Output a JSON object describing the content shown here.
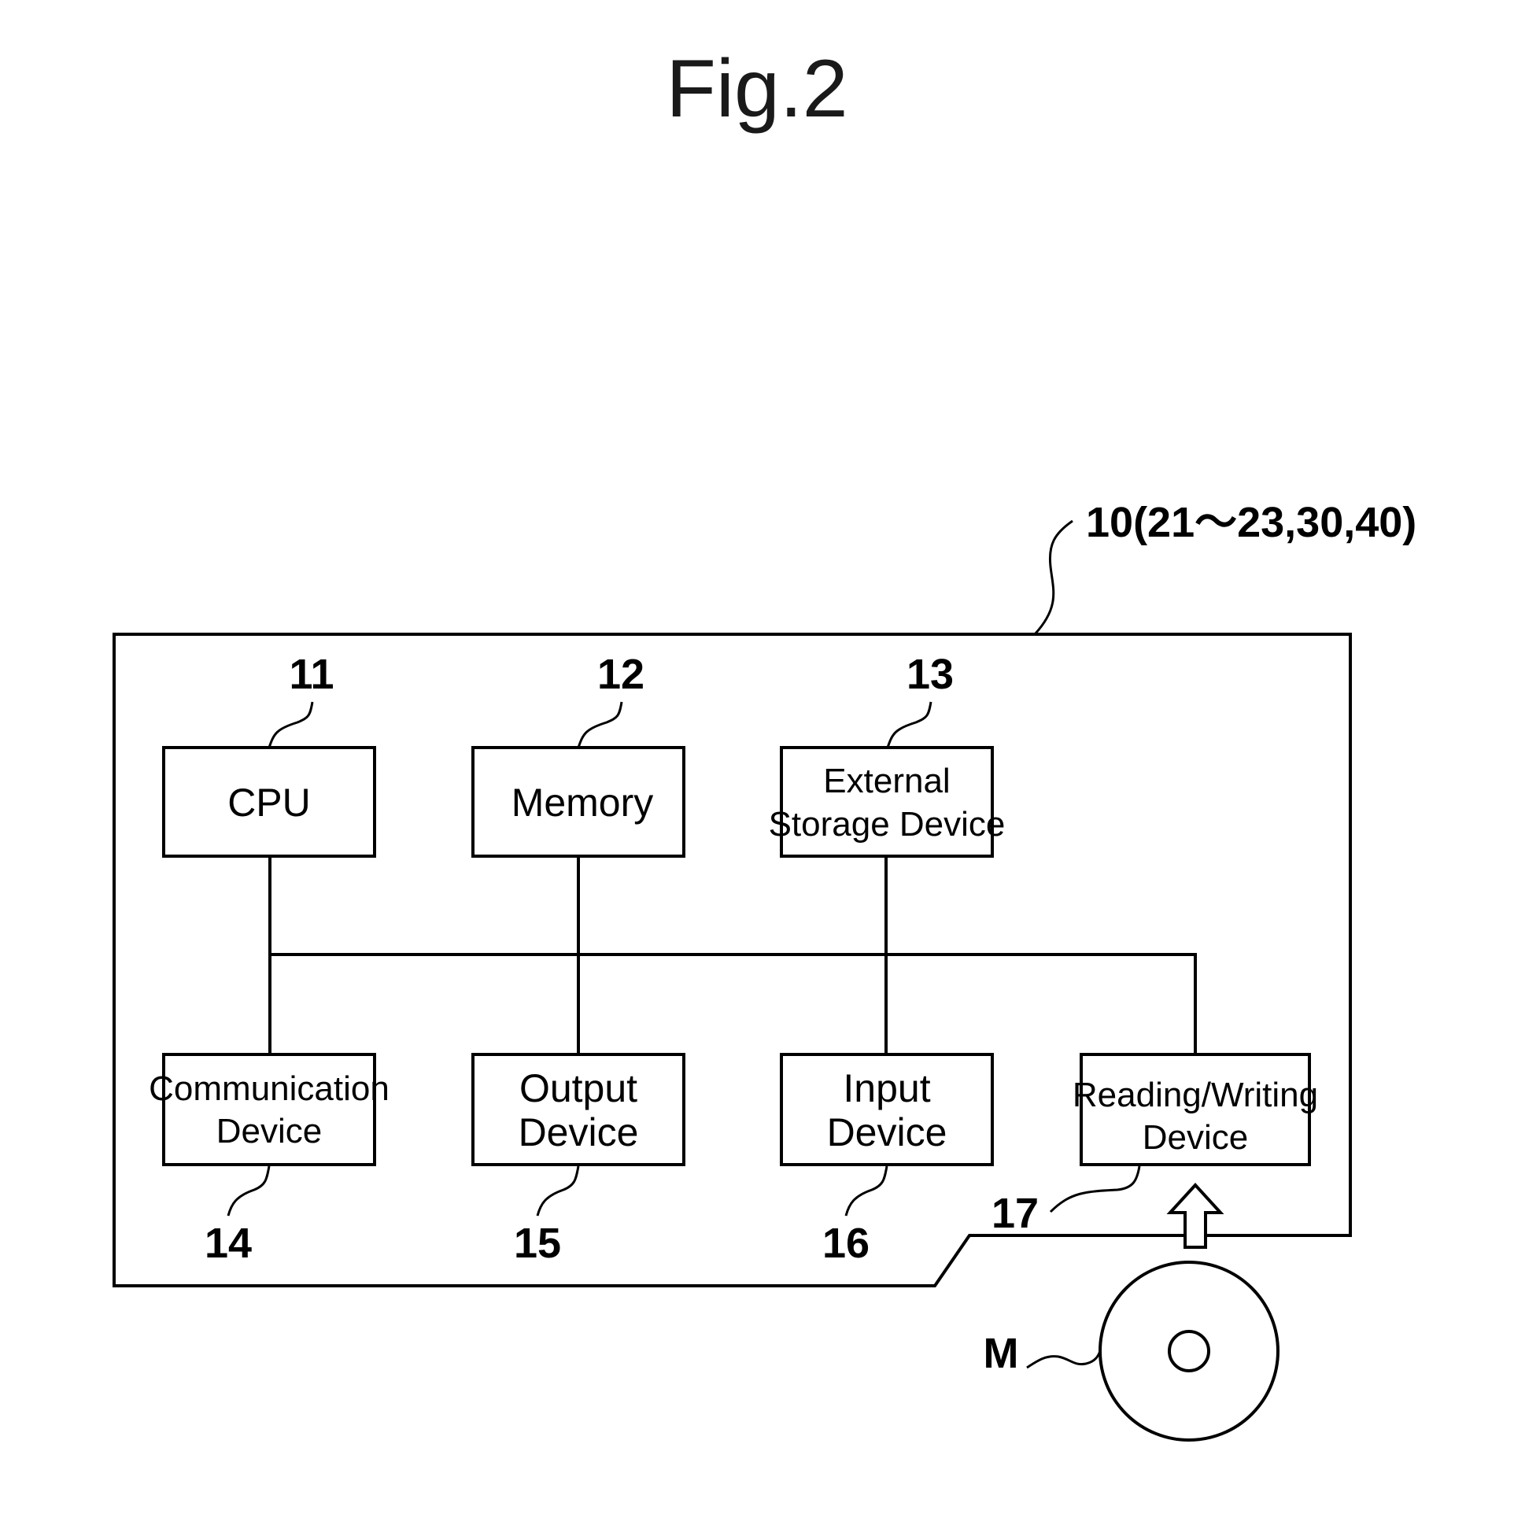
{
  "figure": {
    "title": "Fig.2",
    "system_label": "10(21〜23,30,40)"
  },
  "components": [
    {
      "ref": "11",
      "lines": [
        "CPU"
      ]
    },
    {
      "ref": "12",
      "lines": [
        "Memory"
      ]
    },
    {
      "ref": "13",
      "lines": [
        "External",
        "Storage Device"
      ]
    },
    {
      "ref": "14",
      "lines": [
        "Communication",
        "Device"
      ]
    },
    {
      "ref": "15",
      "lines": [
        "Output",
        "Device"
      ]
    },
    {
      "ref": "16",
      "lines": [
        "Input",
        "Device"
      ]
    },
    {
      "ref": "17",
      "lines": [
        "Reading/Writing",
        "Device"
      ]
    }
  ],
  "medium": {
    "label": "M"
  },
  "connections": [
    {
      "from": "11",
      "to": "bus"
    },
    {
      "from": "12",
      "to": "bus"
    },
    {
      "from": "13",
      "to": "bus"
    },
    {
      "from": "14",
      "to": "bus"
    },
    {
      "from": "15",
      "to": "bus"
    },
    {
      "from": "16",
      "to": "bus"
    },
    {
      "from": "17",
      "to": "bus"
    },
    {
      "from": "M",
      "to": "17",
      "kind": "arrow"
    }
  ]
}
